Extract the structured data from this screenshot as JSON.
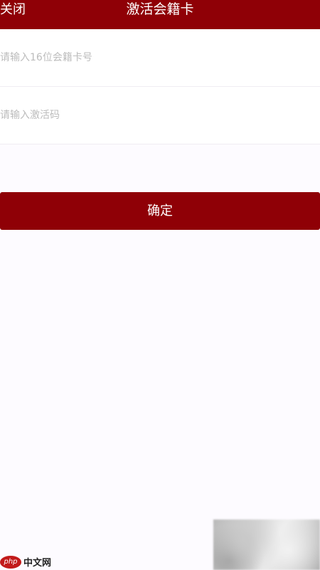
{
  "header": {
    "close_label": "关闭",
    "title": "激活会籍卡"
  },
  "form": {
    "card_number_placeholder": "请输入16位会籍卡号",
    "activation_code_placeholder": "请输入激活码",
    "confirm_label": "确定"
  },
  "watermark": {
    "logo_text": "php",
    "site_text": "中文网"
  },
  "colors": {
    "brand": "#8f0006",
    "background": "#fdfbff"
  }
}
